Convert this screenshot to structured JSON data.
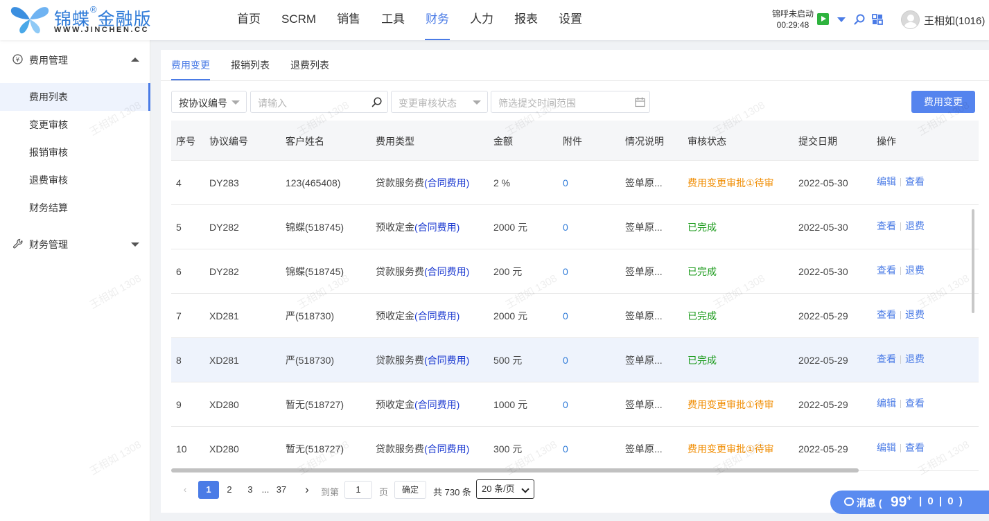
{
  "brand": {
    "name": "锦蝶",
    "reg": "®",
    "edition": "金融版",
    "domain": "WWW.JINCHEN.CC"
  },
  "nav": {
    "items": [
      {
        "label": "首页"
      },
      {
        "label": "SCRM"
      },
      {
        "label": "销售"
      },
      {
        "label": "工具"
      },
      {
        "label": "财务"
      },
      {
        "label": "人力"
      },
      {
        "label": "报表"
      },
      {
        "label": "设置"
      }
    ],
    "active": "财务"
  },
  "header": {
    "call_status": "锦呼未启动",
    "call_timer": "00:29:48",
    "user": "王相如(1016)"
  },
  "sidebar": {
    "groups": [
      {
        "label": "费用管理",
        "icon": "yen-circle-icon",
        "expanded": true
      },
      {
        "label": "财务管理",
        "icon": "wrench-icon",
        "expanded": false
      }
    ],
    "items": [
      {
        "label": "费用列表",
        "active": true
      },
      {
        "label": "变更审核"
      },
      {
        "label": "报销审核"
      },
      {
        "label": "退费审核"
      },
      {
        "label": "财务结算"
      }
    ]
  },
  "tabs": [
    {
      "label": "费用变更",
      "active": true
    },
    {
      "label": "报销列表"
    },
    {
      "label": "退费列表"
    }
  ],
  "filters": {
    "search_by": "按协议编号",
    "search_placeholder": "请输入",
    "status_placeholder": "变更审核状态",
    "date_placeholder": "筛选提交时间范围",
    "action_button": "费用变更"
  },
  "table": {
    "columns": [
      "序号",
      "协议编号",
      "客户姓名",
      "费用类型",
      "金额",
      "附件",
      "情况说明",
      "审核状态",
      "提交日期",
      "操作"
    ],
    "rows": [
      {
        "no": "4",
        "code": "DY283",
        "customer": "123(465408)",
        "type": "贷款服务费",
        "type_tag": "(合同费用)",
        "amount": "2 %",
        "attach": "0",
        "note": "签单原...",
        "status": "费用变更审批①待审",
        "status_color": "#f08c00",
        "date": "2022-05-30",
        "op1": "编辑",
        "op2": "查看"
      },
      {
        "no": "5",
        "code": "DY282",
        "customer": "锦蝶(518745)",
        "type": "预收定金",
        "type_tag": "(合同费用)",
        "amount": "2000 元",
        "attach": "0",
        "note": "签单原...",
        "status": "已完成",
        "status_color": "#1a9a1a",
        "date": "2022-05-30",
        "op1": "查看",
        "op2": "退费"
      },
      {
        "no": "6",
        "code": "DY282",
        "customer": "锦蝶(518745)",
        "type": "贷款服务费",
        "type_tag": "(合同费用)",
        "amount": "200 元",
        "attach": "0",
        "note": "签单原...",
        "status": "已完成",
        "status_color": "#1a9a1a",
        "date": "2022-05-30",
        "op1": "查看",
        "op2": "退费"
      },
      {
        "no": "7",
        "code": "XD281",
        "customer": "严(518730)",
        "type": "预收定金",
        "type_tag": "(合同费用)",
        "amount": "2000 元",
        "attach": "0",
        "note": "签单原...",
        "status": "已完成",
        "status_color": "#1a9a1a",
        "date": "2022-05-29",
        "op1": "查看",
        "op2": "退费"
      },
      {
        "no": "8",
        "code": "XD281",
        "customer": "严(518730)",
        "type": "贷款服务费",
        "type_tag": "(合同费用)",
        "amount": "500 元",
        "attach": "0",
        "note": "签单原...",
        "status": "已完成",
        "status_color": "#1a9a1a",
        "date": "2022-05-29",
        "op1": "查看",
        "op2": "退费",
        "highlight": true
      },
      {
        "no": "9",
        "code": "XD280",
        "customer": "暂无(518727)",
        "type": "预收定金",
        "type_tag": "(合同费用)",
        "amount": "1000 元",
        "attach": "0",
        "note": "签单原...",
        "status": "费用变更审批①待审",
        "status_color": "#f08c00",
        "date": "2022-05-29",
        "op1": "编辑",
        "op2": "查看"
      },
      {
        "no": "10",
        "code": "XD280",
        "customer": "暂无(518727)",
        "type": "贷款服务费",
        "type_tag": "(合同费用)",
        "amount": "300 元",
        "attach": "0",
        "note": "签单原...",
        "status": "费用变更审批①待审",
        "status_color": "#f08c00",
        "date": "2022-05-29",
        "op1": "编辑",
        "op2": "查看"
      }
    ]
  },
  "pagination": {
    "pages": [
      "1",
      "2",
      "3",
      "...",
      "37"
    ],
    "current": "1",
    "goto_label": "到第",
    "goto_value": "1",
    "page_unit": "页",
    "confirm": "确定",
    "total": "共 730 条",
    "page_size": "20 条/页"
  },
  "messages": {
    "label": "消息 (",
    "count": "99",
    "count_suffix": "+",
    "rest": "| 0 | 0 )"
  },
  "watermark": "王相如 1308"
}
